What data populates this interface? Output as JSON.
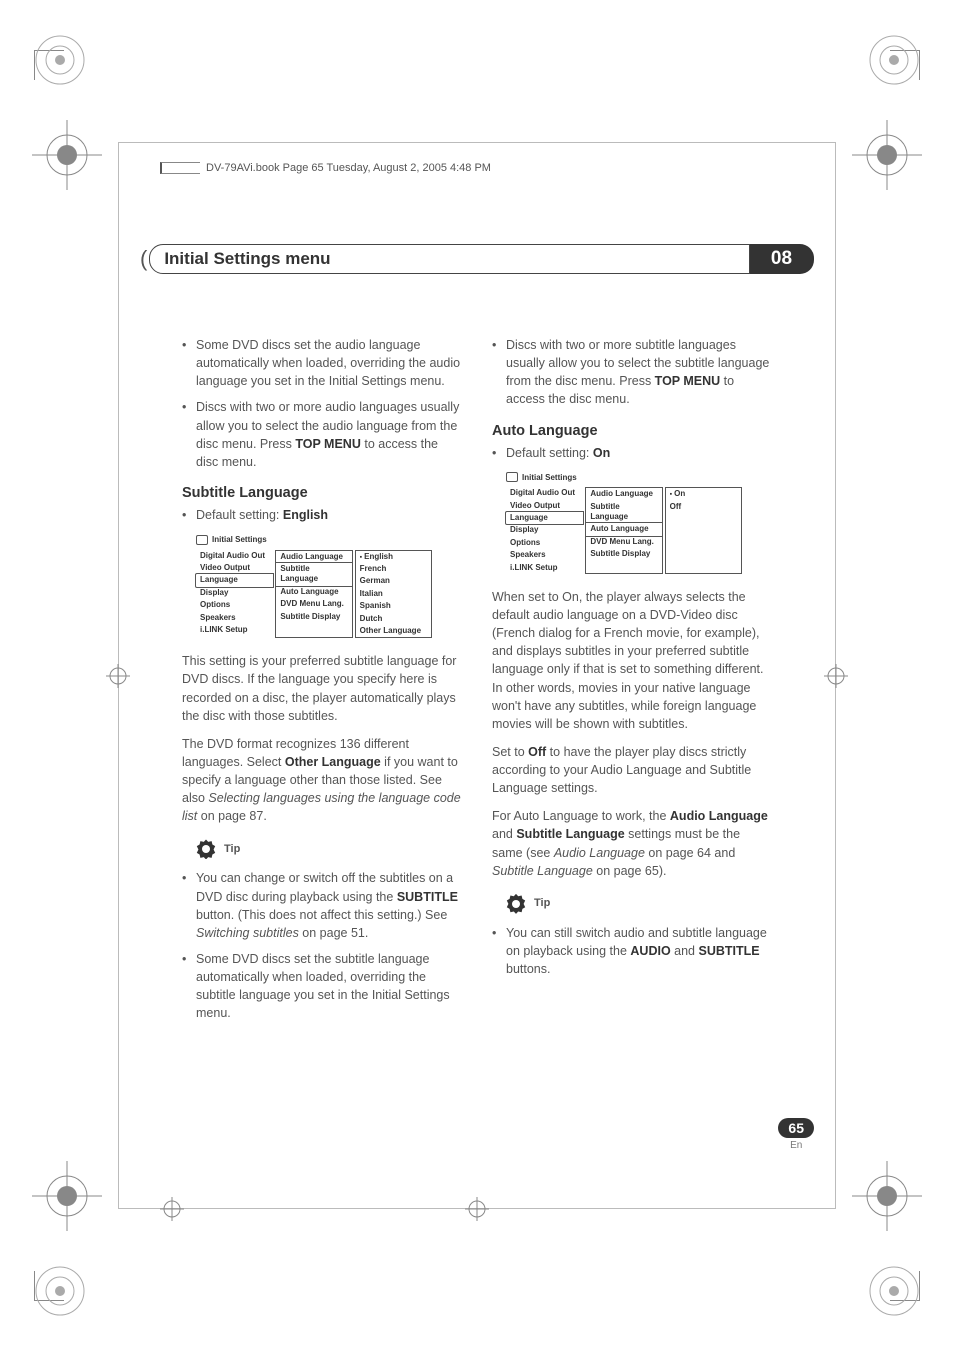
{
  "book_header": "DV-79AVi.book  Page 65  Tuesday, August 2, 2005  4:48 PM",
  "chapter": {
    "title": "Initial Settings menu",
    "number": "08"
  },
  "left": {
    "bullets_top": [
      {
        "text_pre": "Some DVD discs set the audio language automatically when loaded, overriding the audio language you set in the Initial Settings menu."
      },
      {
        "text_pre": "Discs with two or more audio languages usually allow you to select the audio language from the disc menu. Press ",
        "bold": "TOP MENU",
        "text_post": " to access the disc menu."
      }
    ],
    "section_title": "Subtitle Language",
    "default_label": "Default setting: ",
    "default_value": "English",
    "menu": {
      "title": "Initial Settings",
      "left": [
        "Digital Audio Out",
        "Video Output",
        "Language",
        "Display",
        "Options",
        "Speakers",
        "i.LINK Setup"
      ],
      "left_sel_index": 2,
      "mid": [
        "Audio Language",
        "Subtitle Language",
        "Auto Language",
        "DVD Menu Lang.",
        "Subtitle Display"
      ],
      "mid_sel_index": 1,
      "right": [
        "English",
        "French",
        "German",
        "Italian",
        "Spanish",
        "Dutch",
        "Other Language"
      ],
      "right_mark_index": 0
    },
    "para1": "This setting is your preferred subtitle language for DVD discs. If the language you specify here is recorded on a disc, the player automatically plays the disc with those subtitles.",
    "para2_pre": "The DVD format recognizes 136 different languages. Select ",
    "para2_bold": "Other Language",
    "para2_mid": " if you want to specify a language other than those listed. See also ",
    "para2_ital": "Selecting languages using the language code list",
    "para2_post": " on page 87.",
    "tip_label": "Tip",
    "tip_bullets": [
      {
        "pre": "You can change or switch off the subtitles on a DVD disc during playback using the ",
        "b1": "SUBTITLE",
        "mid": " button. (This does not affect this setting.) See ",
        "ital": "Switching subtitles",
        "post": " on page 51."
      },
      {
        "pre": "Some DVD discs set the subtitle language automatically when loaded, overriding the subtitle language you set in the Initial Settings menu."
      }
    ]
  },
  "right": {
    "bullets_top": [
      {
        "pre": "Discs with two or more subtitle languages usually allow you to select the subtitle language from the disc menu. Press ",
        "bold": "TOP MENU",
        "post": " to access the disc menu."
      }
    ],
    "section_title": "Auto Language",
    "default_label": "Default setting: ",
    "default_value": "On",
    "menu": {
      "title": "Initial Settings",
      "left": [
        "Digital Audio Out",
        "Video Output",
        "Language",
        "Display",
        "Options",
        "Speakers",
        "i.LINK Setup"
      ],
      "left_sel_index": 2,
      "mid": [
        "Audio Language",
        "Subtitle Language",
        "Auto Language",
        "DVD Menu Lang.",
        "Subtitle Display"
      ],
      "mid_sel_index": 2,
      "right": [
        "On",
        "Off"
      ],
      "right_mark_index": 0
    },
    "para1": "When set to On, the player always selects the default audio language on a DVD-Video disc (French dialog for a French movie, for example), and displays subtitles in your preferred subtitle language only if that is set to something different. In other words, movies in your native language won't have any subtitles, while foreign language movies will be shown with subtitles.",
    "para2_pre": "Set to ",
    "para2_bold": "Off",
    "para2_post": " to have the player play discs strictly according to your Audio Language and Subtitle Language settings.",
    "para3_pre": "For Auto Language to work, the ",
    "para3_b1": "Audio Language",
    "para3_mid1": " and ",
    "para3_b2": "Subtitle Language",
    "para3_mid2": " settings must be the same (see ",
    "para3_i1": "Audio Language",
    "para3_mid3": " on page 64 and ",
    "para3_i2": "Subtitle Language",
    "para3_post": " on page 65).",
    "tip_label": "Tip",
    "tip_bullets": [
      {
        "pre": "You can still switch audio and subtitle language on playback using the ",
        "b1": "AUDIO",
        "mid": " and ",
        "b2": "SUBTITLE",
        "post": " buttons."
      }
    ]
  },
  "page": {
    "num": "65",
    "lang": "En"
  }
}
